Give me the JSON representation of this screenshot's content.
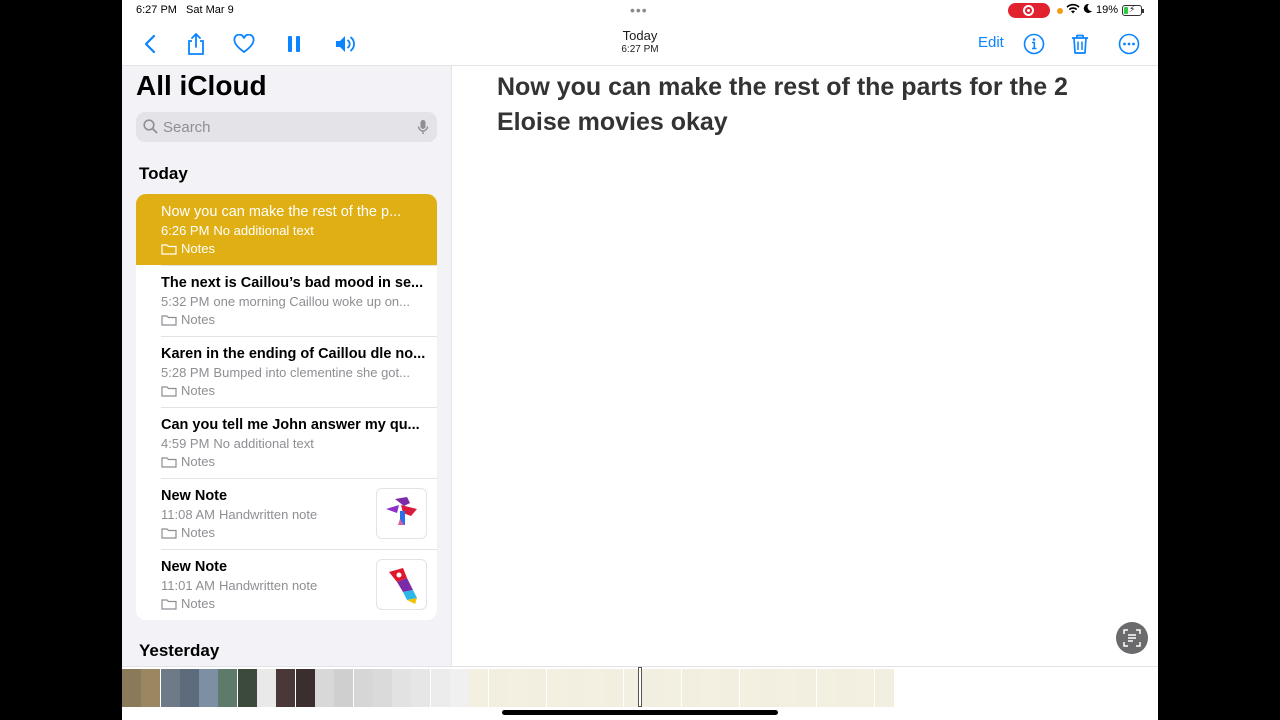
{
  "status": {
    "time": "6:27 PM",
    "date": "Sat Mar 9",
    "battery": "19%",
    "battery_level": 0.19
  },
  "toolbar": {
    "title": "Today",
    "subtitle": "6:27 PM",
    "edit_label": "Edit",
    "icons": [
      "chevron-left-icon",
      "share-icon",
      "heart-icon",
      "pause-icon",
      "speaker-icon",
      "info-icon",
      "trash-icon",
      "more-icon"
    ]
  },
  "sidebar": {
    "title": "All iCloud",
    "search_placeholder": "Search",
    "section_today": "Today",
    "section_yesterday": "Yesterday",
    "notes": [
      {
        "title": "Now you can make the rest of the p...",
        "time": "6:26 PM",
        "preview": "No additional text",
        "folder": "Notes",
        "selected": true,
        "thumbnail": false
      },
      {
        "title": "The next is Caillou’s bad mood in se...",
        "time": "5:32 PM",
        "preview": "one morning Caillou woke up on...",
        "folder": "Notes",
        "selected": false,
        "thumbnail": false
      },
      {
        "title": "Karen in the ending of Caillou dle no...",
        "time": "5:28 PM",
        "preview": "Bumped into clementine she got...",
        "folder": "Notes",
        "selected": false,
        "thumbnail": false
      },
      {
        "title": "Can you tell me John answer my qu...",
        "time": "4:59 PM",
        "preview": "No additional text",
        "folder": "Notes",
        "selected": false,
        "thumbnail": false
      },
      {
        "title": "New Note",
        "time": "11:08 AM",
        "preview": "Handwritten note",
        "folder": "Notes",
        "selected": false,
        "thumbnail": true
      },
      {
        "title": "New Note",
        "time": "11:01 AM",
        "preview": "Handwritten note",
        "folder": "Notes",
        "selected": false,
        "thumbnail": true
      }
    ]
  },
  "editor": {
    "body": "Now you can make the rest of the parts for the 2 Eloise movies okay"
  },
  "colors": {
    "accent": "#0a84ff",
    "selected_note": "#e0af13",
    "recording": "#e0232f"
  }
}
